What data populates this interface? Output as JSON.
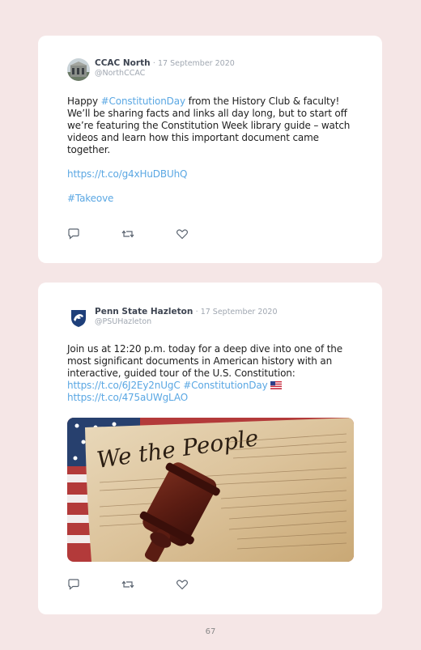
{
  "posts": [
    {
      "author": "CCAC North",
      "date": "· 17 September 2020",
      "handle": "@NorthCCAC",
      "text_1": "Happy ",
      "hashtag_1": "#ConstitutionDay",
      "text_2": " from the History Club & faculty! We’ll be sharing facts and links all day long, but to start off we’re featuring the Constitution Week library guide – watch videos and learn how this important document came together.",
      "link": "https://t.co/g4xHuDBUhQ",
      "hashtag_2": "#Takeove",
      "avatar_icon": "building-photo-avatar"
    },
    {
      "author": "Penn State Hazleton",
      "date": "· 17 September 2020",
      "handle": "@PSUHazleton",
      "text_1": "Join us at 12:20 p.m. today for a deep dive into one of the most significant documents in American history with an interactive, guided tour of the U.S. Constitution:",
      "link_1": "https://t.co/6J2Ey2nUgC",
      "hashtag_1": "#ConstitutionDay",
      "link_2": "https://t.co/475aUWgLAO",
      "image_caption": "We the People",
      "avatar_icon": "penn-state-shield-logo"
    }
  ],
  "action_icons": [
    "reply-icon",
    "retweet-icon",
    "like-icon"
  ],
  "page_number": "67",
  "colors": {
    "background": "#f5e6e6",
    "card": "#ffffff",
    "link": "#5aa7e3",
    "name": "#3d4451",
    "muted": "#a0a7b1"
  }
}
